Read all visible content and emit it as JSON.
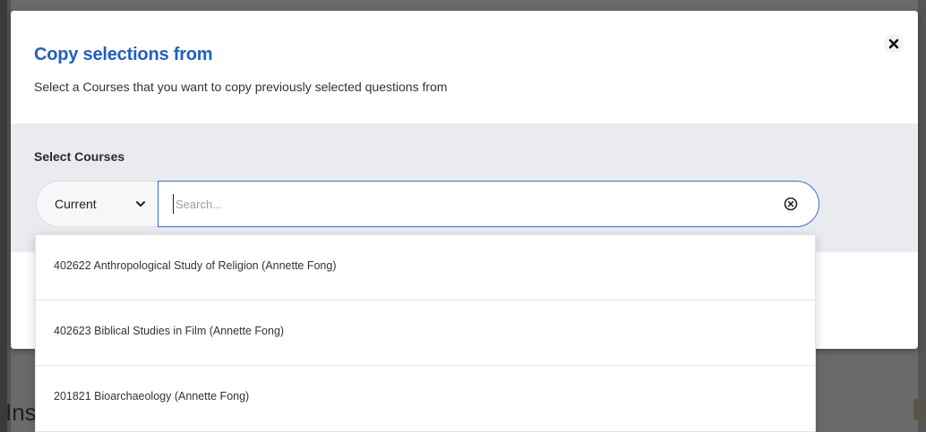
{
  "background": {
    "bottom_text": "Ins"
  },
  "modal": {
    "title": "Copy selections from",
    "subtitle": "Select a Courses that you want to copy previously selected questions from",
    "close_icon": "close-icon",
    "select_label": "Select Courses",
    "scope_select": {
      "selected": "Current",
      "icon": "chevron-down-icon"
    },
    "search": {
      "placeholder": "Search...",
      "value": "",
      "clear_icon": "clear-circle-icon"
    }
  },
  "dropdown": {
    "options": [
      {
        "label": "402622 Anthropological Study of Religion (Annette Fong)"
      },
      {
        "label": "402623 Biblical Studies in Film (Annette Fong)"
      },
      {
        "label": "201821 Bioarchaeology (Annette Fong)"
      }
    ]
  },
  "colors": {
    "title": "#1f5fc6",
    "search_border": "#3b6fd8",
    "body_band": "#e9ebee",
    "overlay": "#6a6a6a"
  }
}
